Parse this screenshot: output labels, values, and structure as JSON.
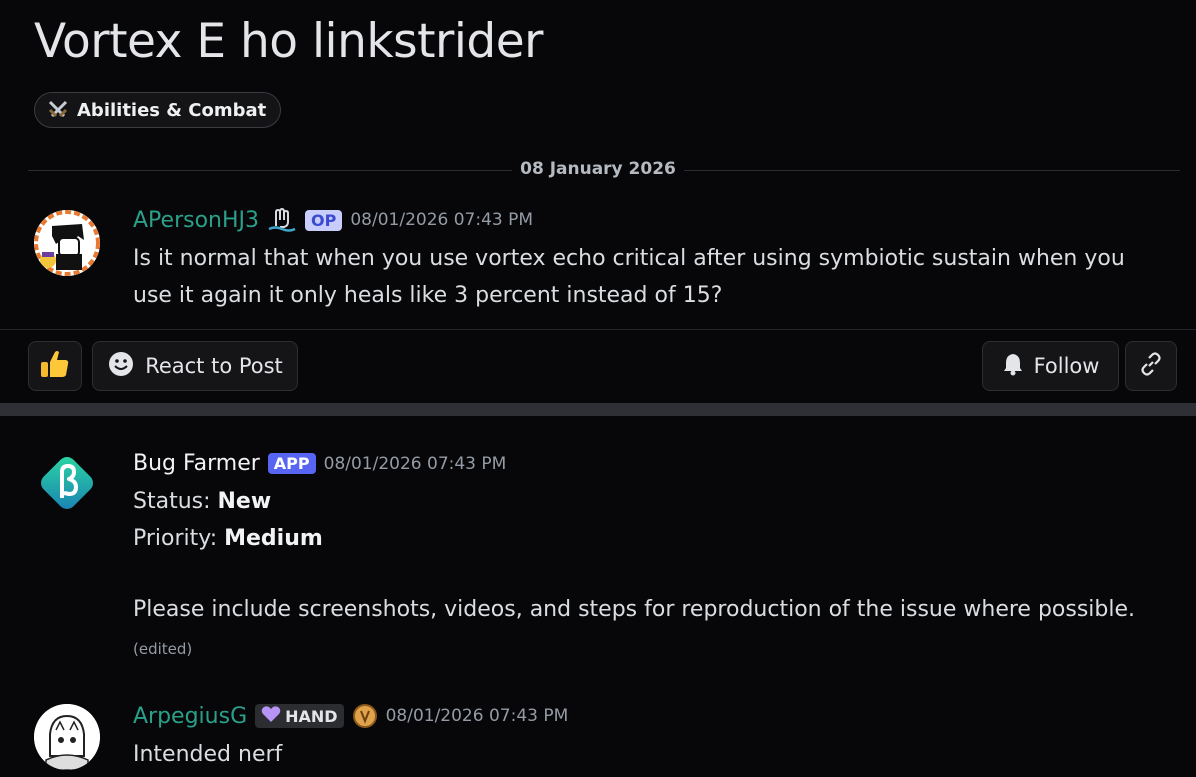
{
  "thread": {
    "title": "Vortex E ho linkstrider",
    "tag": {
      "icon": "crossed-swords-icon",
      "label": "Abilities & Combat"
    },
    "date_divider": "08 January 2026"
  },
  "post": {
    "author": "APersonHJ3",
    "author_color": "#2aa08a",
    "badge": "OP",
    "timestamp": "08/01/2026 07:43 PM",
    "text": "Is it normal that when you use vortex echo critical after using symbiotic sustain when you use it again it only heals like 3 percent instead of 15?"
  },
  "actions": {
    "react_label": "React to Post",
    "follow_label": "Follow"
  },
  "replies": [
    {
      "author": "Bug Farmer",
      "badge": "APP",
      "timestamp": "08/01/2026 07:43 PM",
      "status_label": "Status: ",
      "status_value": "New",
      "priority_label": "Priority: ",
      "priority_value": "Medium",
      "note": "Please include screenshots, videos, and steps for reproduction of the issue where possible.",
      "edited": "(edited)"
    },
    {
      "author": "ArpegiusG",
      "author_color": "#2aa08a",
      "badge": "HAND",
      "timestamp": "08/01/2026 07:43 PM",
      "text": "Intended nerf"
    }
  ],
  "colors": {
    "background": "#070709",
    "app_badge": "#5865f2",
    "op_badge": "#c9cdfb",
    "bug_farmer_gradient": [
      "#2bd9a0",
      "#1a7fb5"
    ]
  }
}
